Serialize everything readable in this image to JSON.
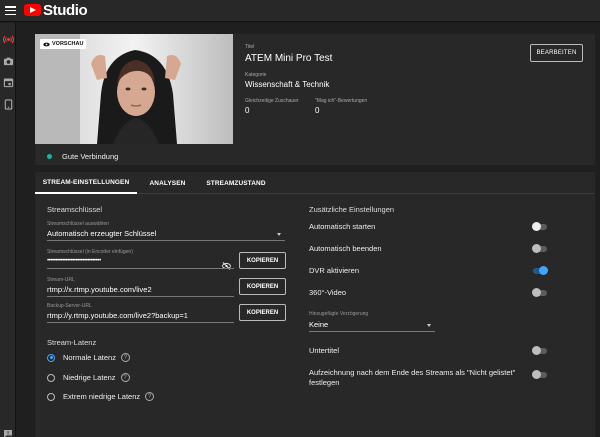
{
  "app": {
    "name": "Studio"
  },
  "preview": {
    "badge": "VORSCHAU",
    "connection": "Gute Verbindung",
    "title_label": "Titel",
    "title": "ATEM Mini Pro Test",
    "category_label": "Kategorie",
    "category": "Wissenschaft & Technik",
    "viewers_label": "Gleichzeitige Zuschauer",
    "viewers": "0",
    "likes_label": "\"Mag ich\"-Bewertungen",
    "likes": "0",
    "edit_button": "BEARBEITEN"
  },
  "tabs": [
    {
      "label": "STREAM-EINSTELLUNGEN",
      "active": true
    },
    {
      "label": "ANALYSEN",
      "active": false
    },
    {
      "label": "STREAMZUSTAND",
      "active": false
    }
  ],
  "stream_key": {
    "section_title": "Streamschlüssel",
    "select_label": "Streamschlüssel auswählen",
    "select_value": "Automatisch erzeugter Schlüssel",
    "key_label": "Streamschlüssel (in Encoder einfügen)",
    "key_value": "••••••••••••••••••••••••••••••••",
    "url_label": "Stream-URL",
    "url_value": "rtmp://x.rtmp.youtube.com/live2",
    "backup_label": "Backup-Server-URL",
    "backup_value": "rtmp://y.rtmp.youtube.com/live2?backup=1",
    "copy_label": "KOPIEREN"
  },
  "latency": {
    "section_title": "Stream-Latenz",
    "options": [
      {
        "label": "Normale Latenz",
        "checked": true
      },
      {
        "label": "Niedrige Latenz",
        "checked": false
      },
      {
        "label": "Extrem niedrige Latenz",
        "checked": false
      }
    ]
  },
  "additional": {
    "section_title": "Zusätzliche Einstellungen",
    "auto_start": {
      "label": "Automatisch starten",
      "on": false
    },
    "auto_end": {
      "label": "Automatisch beenden",
      "on": false
    },
    "dvr": {
      "label": "DVR aktivieren",
      "on": true
    },
    "vr360": {
      "label": "360°-Video",
      "on": false
    },
    "delay_label": "Hinzugefügte Verzögerung",
    "delay_value": "Keine",
    "subtitles": {
      "label": "Untertitel",
      "on": false
    },
    "unlisted": {
      "label": "Aufzeichnung nach dem Ende des Streams als \"Nicht gelistet\" festlegen",
      "on": false
    }
  },
  "colors": {
    "accent": "#3ea6ff",
    "status_good": "#1bb3a5",
    "brand": "#ff0000"
  }
}
